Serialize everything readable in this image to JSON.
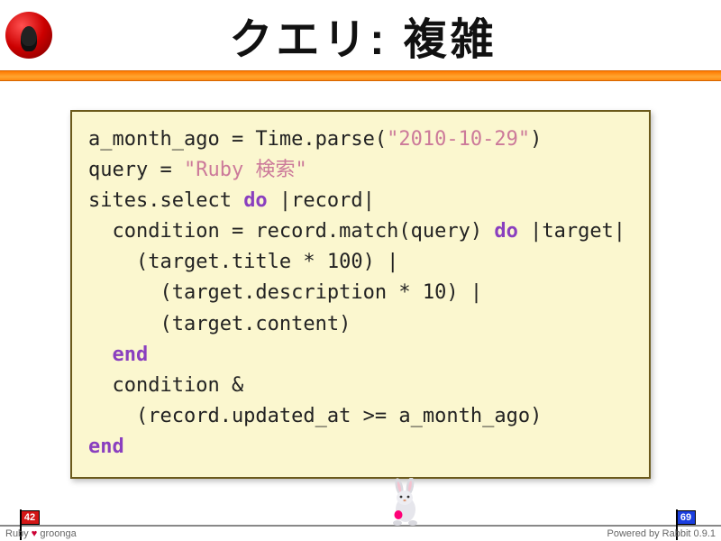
{
  "title": "クエリ: 複雑",
  "code": {
    "l1a": "a_month_ago = Time.parse(",
    "l1b": "\"2010-10-29\"",
    "l1c": ")",
    "l2a": "query = ",
    "l2b": "\"Ruby 検索\"",
    "l3a": "sites.select ",
    "l3kw": "do",
    "l3b": " |record|",
    "l4a": "  condition = record.match(query) ",
    "l4kw": "do",
    "l4b": " |target|",
    "l5": "    (target.title * 100) |",
    "l6": "      (target.description * 10) |",
    "l7": "      (target.content)",
    "l8": "  ",
    "l8kw": "end",
    "l9": "  condition &",
    "l10": "    (record.updated_at >= a_month_ago)",
    "l11kw": "end"
  },
  "flags": {
    "left": "42",
    "right": "69"
  },
  "footer": {
    "left_a": "Ruby ",
    "left_heart": "♥",
    "left_b": " groonga",
    "right": "Powered by Rabbit 0.9.1"
  }
}
